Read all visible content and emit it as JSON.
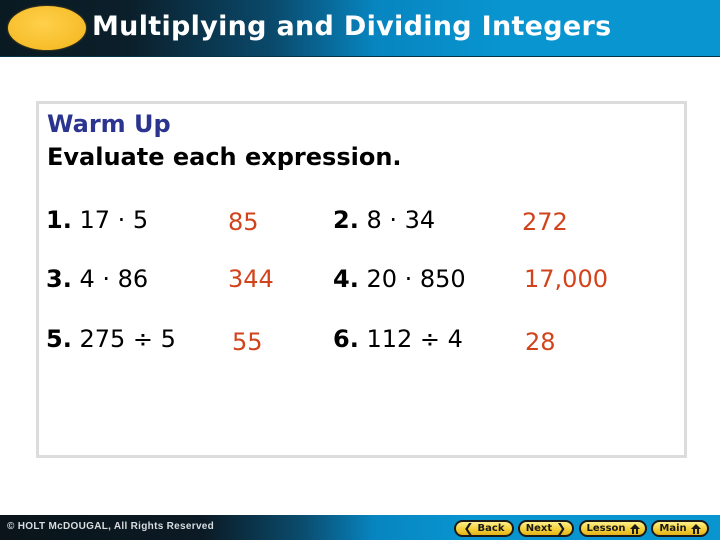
{
  "header": {
    "title": "Multiplying and Dividing Integers",
    "accent_color": "#f6bd2a",
    "bar_color": "#0895d0"
  },
  "content": {
    "section_title": "Warm Up",
    "instructions": "Evaluate each expression.",
    "problems": [
      {
        "number": "1.",
        "expression": "17 · 5",
        "answer": "85"
      },
      {
        "number": "2.",
        "expression": "8 · 34",
        "answer": "272"
      },
      {
        "number": "3.",
        "expression": "4 · 86",
        "answer": "344"
      },
      {
        "number": "4.",
        "expression": "20 · 850",
        "answer": "17,000"
      },
      {
        "number": "5.",
        "expression": "275 ÷ 5",
        "answer": "55"
      },
      {
        "number": "6.",
        "expression": "112 ÷ 4",
        "answer": "28"
      }
    ],
    "answer_color": "#d2431c",
    "title_color": "#2b3590"
  },
  "footer": {
    "copyright": "© HOLT McDOUGAL, All Rights Reserved",
    "buttons": {
      "back": {
        "label": "Back",
        "icon": "chevron-left-icon"
      },
      "next": {
        "label": "Next",
        "icon": "chevron-right-icon"
      },
      "lesson": {
        "label": "Lesson",
        "icon": "home-icon"
      },
      "main": {
        "label": "Main",
        "icon": "home-icon"
      }
    }
  }
}
